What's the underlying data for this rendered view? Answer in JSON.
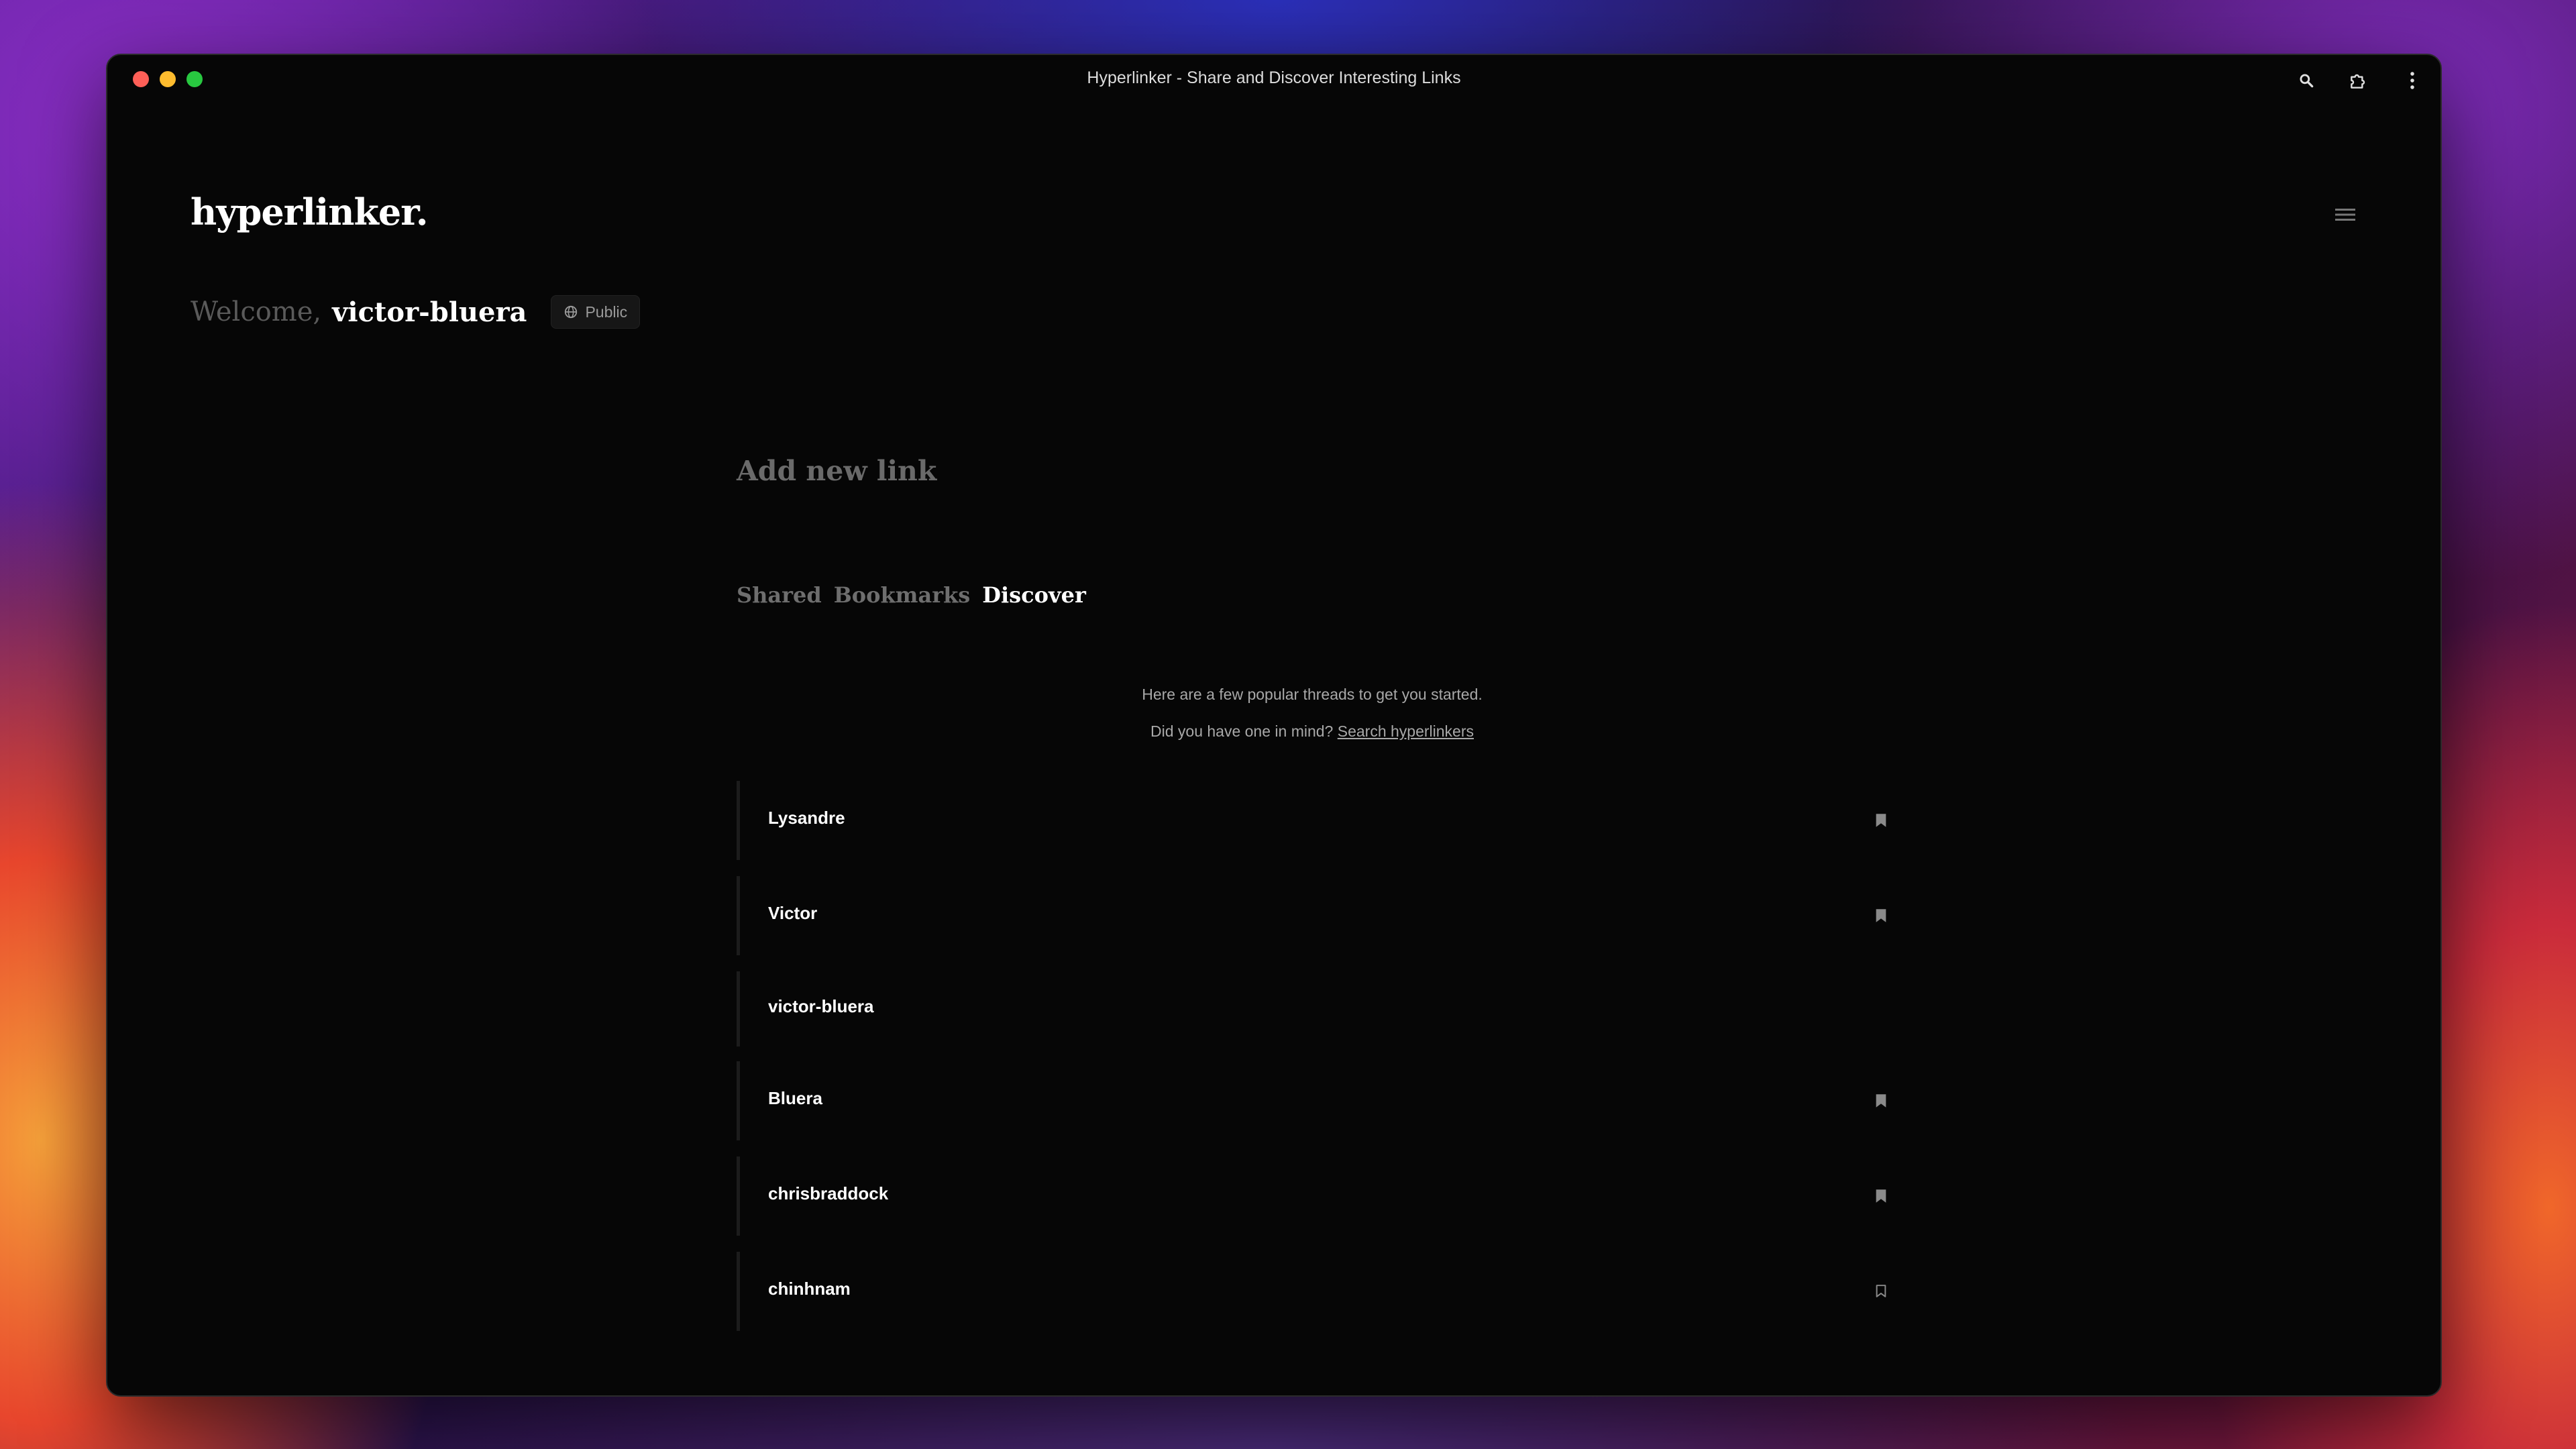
{
  "window": {
    "title": "Hyperlinker - Share and Discover Interesting Links"
  },
  "toolbar_icons": [
    "search-icon",
    "extension-icon",
    "more-vertical-icon"
  ],
  "header": {
    "logo": "hyperlinker.",
    "menu_icon": "hamburger-menu-icon"
  },
  "welcome": {
    "greeting": "Welcome,",
    "username": "victor-bluera",
    "visibility": "Public"
  },
  "add_link": {
    "label": "Add new link"
  },
  "tabs": [
    {
      "label": "Shared",
      "active": false
    },
    {
      "label": "Bookmarks",
      "active": false
    },
    {
      "label": "Discover",
      "active": true
    }
  ],
  "intro": {
    "line1": "Here are a few popular threads to get you started.",
    "line2_prefix": "Did you have one in mind?",
    "line2_link": "Search hyperlinkers"
  },
  "threads": [
    {
      "name": "Lysandre",
      "bookmark": "filled"
    },
    {
      "name": "Victor",
      "bookmark": "filled"
    },
    {
      "name": "victor-bluera",
      "bookmark": "none"
    },
    {
      "name": "Bluera",
      "bookmark": "filled"
    },
    {
      "name": "chrisbraddock",
      "bookmark": "filled"
    },
    {
      "name": "chinhnam",
      "bookmark": "outline"
    }
  ],
  "colors": {
    "background": "#060606",
    "text_primary": "#ffffff",
    "text_muted": "#6e6e6e",
    "traffic_red": "#fe5f57",
    "traffic_yellow": "#febc2e",
    "traffic_green": "#28c840"
  }
}
